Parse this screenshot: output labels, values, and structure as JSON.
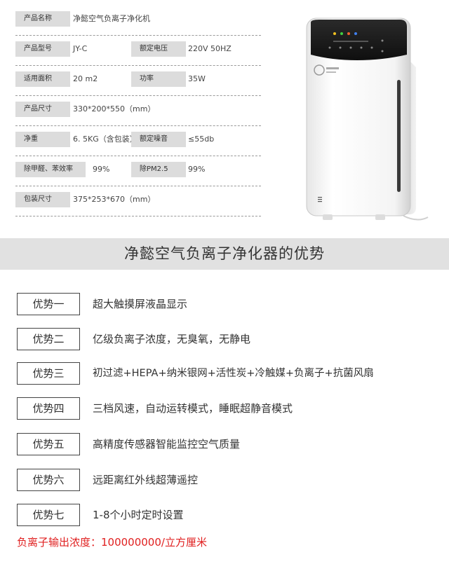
{
  "specs": {
    "row1": {
      "label": "产品名称",
      "value": "净懿空气负离子净化机"
    },
    "row2": {
      "label1": "产品型号",
      "value1": "JY-C",
      "label2": "额定电压",
      "value2": "220V 50HZ"
    },
    "row3": {
      "label1": "适用面积",
      "value1": "20 m2",
      "label2": "功率",
      "value2": "35W"
    },
    "row4": {
      "label": "产品尺寸",
      "value": "330*200*550（mm）"
    },
    "row5": {
      "label1": "净重",
      "value1": "6. 5KG（含包装）",
      "label2": "额定噪音",
      "value2": "≤55db"
    },
    "row6": {
      "label1": "除甲醛、苯效率",
      "value1": "99%",
      "label2": "除PM2.5",
      "value2": "99%"
    },
    "row7": {
      "label": "包装尺寸",
      "value": "375*253*670（mm）"
    }
  },
  "section_title": "净懿空气负离子净化器的优势",
  "advantages": [
    {
      "badge": "优势一",
      "text": "超大触摸屏液晶显示"
    },
    {
      "badge": "优势二",
      "text": "亿级负离子浓度，无臭氧，无静电"
    },
    {
      "badge": "优势三",
      "text": "初过滤+HEPA+纳米银网+活性炭+冷触媒+负离子+抗菌风扇"
    },
    {
      "badge": "优势四",
      "text": "三档风速，自动运转模式，睡眠超静音模式"
    },
    {
      "badge": "优势五",
      "text": "高精度传感器智能监控空气质量"
    },
    {
      "badge": "优势六",
      "text": "远距离红外线超薄遥控"
    },
    {
      "badge": "优势七",
      "text": "1-8个小时定时设置"
    }
  ],
  "footnote": "负离子输出浓度：100000000/立方厘米",
  "colors": {
    "footnote": "#e02020",
    "label_bg": "#dcdcdc",
    "section_bg": "#e1e1e1"
  }
}
